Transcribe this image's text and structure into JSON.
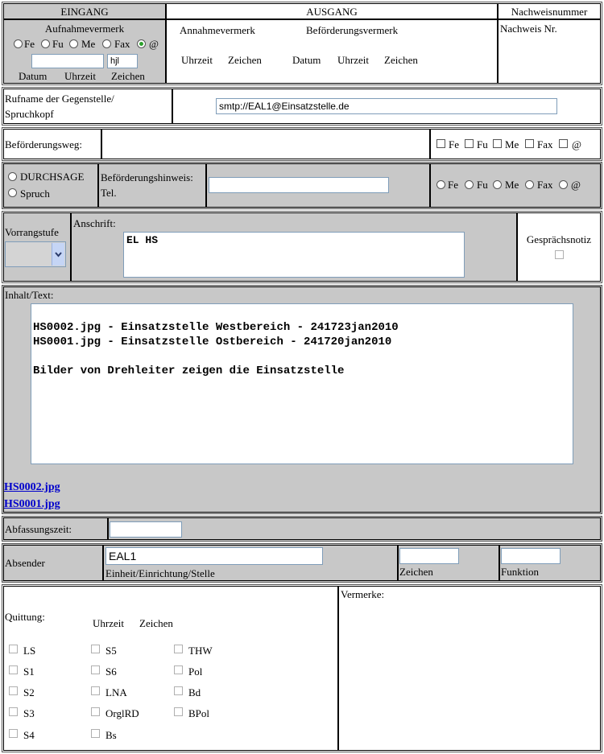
{
  "header": {
    "eingang": "EINGANG",
    "ausgang": "AUSGANG",
    "nachweisnummer": "Nachweisnummer"
  },
  "eingang": {
    "aufnahmevermerk": "Aufnahmevermerk",
    "radios": [
      "Fe",
      "Fu",
      "Me",
      "Fax",
      "@"
    ],
    "selected": "@",
    "datum_value": "",
    "zeichen_value": "hjl",
    "labels": [
      "Datum",
      "Uhrzeit",
      "Zeichen"
    ]
  },
  "ausgang": {
    "annahmevermerk": "Annahmevermerk",
    "befoerderungsvermerk": "Beförderungsvermerk",
    "annahme_labels": [
      "Uhrzeit",
      "Zeichen"
    ],
    "befoerderung_labels": [
      "Datum",
      "Uhrzeit",
      "Zeichen"
    ]
  },
  "nachweis": {
    "label": "Nachweis Nr."
  },
  "rufname": {
    "label_line1": "Rufname der Gegenstelle/",
    "label_line2": "Spruchkopf",
    "value": "smtp://EAL1@Einsatzstelle.de"
  },
  "befoerderungsweg": {
    "label": "Beförderungsweg:",
    "checks": [
      "Fe",
      "Fu",
      "Me",
      "Fax",
      "@"
    ]
  },
  "durchsage": {
    "options": [
      "DURCHSAGE",
      "Spruch"
    ],
    "hinweis_line1": "Beförderungshinweis:",
    "hinweis_line2": "Tel.",
    "hinweis_value": "",
    "radios": [
      "Fe",
      "Fu",
      "Me",
      "Fax",
      "@"
    ]
  },
  "vorrang": {
    "label": "Vorrangstufe",
    "anschrift_label": "Anschrift:",
    "anschrift_value": "EL HS",
    "gespraechsnotiz": "Gesprächsnotiz"
  },
  "inhalt": {
    "label": "Inhalt/Text:",
    "text": "\nHS0002.jpg - Einsatzstelle Westbereich - 241723jan2010\nHS0001.jpg - Einsatzstelle Ostbereich - 241720jan2010\n\nBilder von Drehleiter zeigen die Einsatzstelle",
    "links": [
      "HS0002.jpg",
      "HS0001.jpg"
    ]
  },
  "abfassung": {
    "label": "Abfassungszeit:",
    "value": ""
  },
  "absender": {
    "label": "Absender",
    "value": "EAL1",
    "einheit_label": "Einheit/Einrichtung/Stelle",
    "zeichen_label": "Zeichen",
    "funktion_label": "Funktion"
  },
  "quittung": {
    "label": "Quittung:",
    "uhrzeit": "Uhrzeit",
    "zeichen": "Zeichen",
    "col1": [
      "LS",
      "S1",
      "S2",
      "S3",
      "S4"
    ],
    "col2": [
      "S5",
      "S6",
      "LNA",
      "OrglRD",
      "Bs"
    ],
    "col3": [
      "THW",
      "Pol",
      "Bd",
      "BPol"
    ]
  },
  "vermerke": {
    "label": "Vermerke:"
  }
}
